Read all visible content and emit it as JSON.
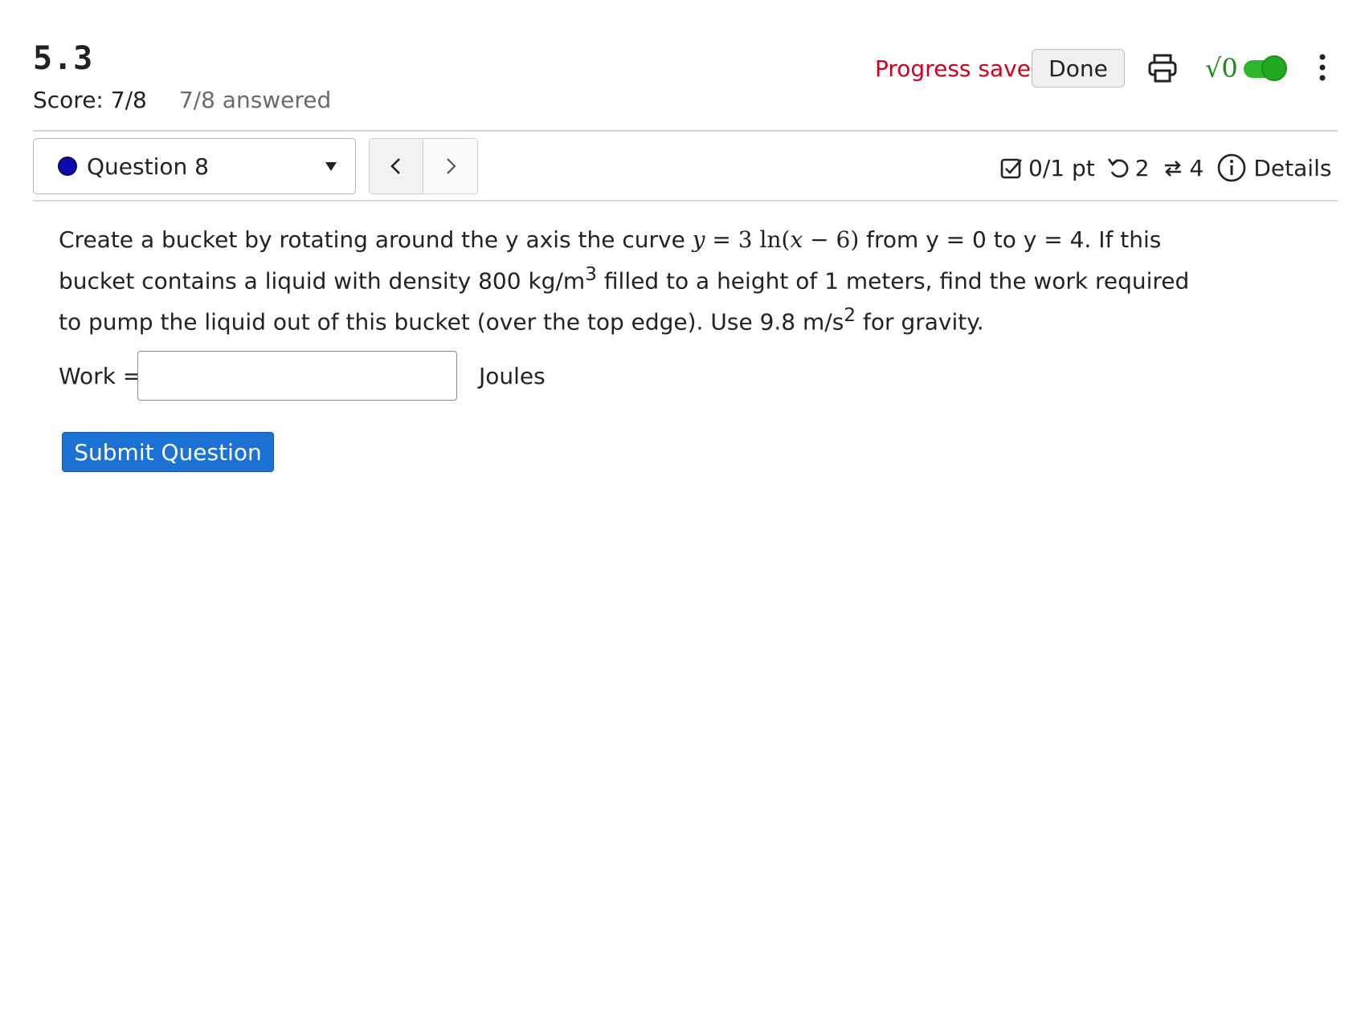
{
  "header": {
    "title": "5.3",
    "score": "Score: 7/8",
    "answered": "7/8 answered",
    "progress_status": "Progress saved",
    "done_label": "Done",
    "math_toggle_label": "√0",
    "icons": [
      "printer-icon",
      "kebab-menu-icon"
    ]
  },
  "question_nav": {
    "selected": "Question 8",
    "status_color": "#0b0bb0",
    "prev_icon": "chevron-left-icon",
    "next_icon": "chevron-right-icon"
  },
  "meta": {
    "points": "0/1 pt",
    "retries": "2",
    "attempts": "4",
    "details_label": "Details"
  },
  "question": {
    "text_1": "Create a bucket by rotating around the y axis the curve ",
    "math_y": "y",
    "math_eq": " = 3 ",
    "math_ln": "ln",
    "math_open": "(",
    "math_x": "x",
    "math_rest": " − 6)",
    "text_2": " from y = 0 to y = 4. If this bucket contains a liquid with density 800 kg/m",
    "sup_1": "3",
    "text_3": " filled to a height of 1 meters, find the work required to pump the liquid out of this bucket (over the top edge). Use 9.8 m/s",
    "sup_2": "2",
    "text_4": " for gravity."
  },
  "answer": {
    "label": "Work =",
    "value": "",
    "units": "Joules"
  },
  "submit_label": "Submit Question",
  "colors": {
    "progress_saved": "#d0021b",
    "submit_bg": "#1b72d4",
    "toggle_green": "#2db52d"
  }
}
